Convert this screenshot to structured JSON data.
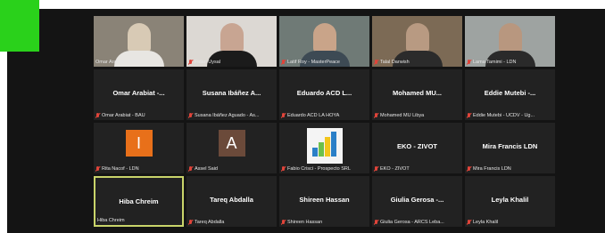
{
  "colors": {
    "background": "#141414",
    "tile": "#222222",
    "active_border": "#c9d46a",
    "mute": "#e0443a",
    "badge": "#2ad11b",
    "avatar_orange": "#e8701a",
    "avatar_brown": "#6b4a3a"
  },
  "tiles": [
    {
      "center": "",
      "label": "Omar Arabiat - BAU",
      "muted": false,
      "type": "video"
    },
    {
      "center": "",
      "label": "Fidan Uysal",
      "muted": true,
      "type": "video"
    },
    {
      "center": "",
      "label": "Latif Roy - MasterPeace",
      "muted": true,
      "type": "video"
    },
    {
      "center": "",
      "label": "Talal Darwish",
      "muted": true,
      "type": "video"
    },
    {
      "center": "",
      "label": "Lama Tamimi - LDN",
      "muted": true,
      "type": "video"
    },
    {
      "center": "Omar Arabiat -...",
      "label": "Omar Arabiat - BAU",
      "muted": true
    },
    {
      "center": "Susana Ibáñez A...",
      "label": "Susana Ibáñez Aguado - As...",
      "muted": true
    },
    {
      "center": "Eduardo ACD L...",
      "label": "Eduardo ACD LA HOYA",
      "muted": true
    },
    {
      "center": "Mohamed  MU...",
      "label": "Mohamed  MU Libya",
      "muted": true
    },
    {
      "center": "Eddie Mutebi -...",
      "label": "Eddie Mutebi - UCDV - Ug...",
      "muted": true
    },
    {
      "center": "",
      "label": "Rita Nacof - LDN",
      "muted": true,
      "avatar": "I"
    },
    {
      "center": "",
      "label": "Assel Said",
      "muted": true,
      "avatar": "A"
    },
    {
      "center": "",
      "label": "Fabio Crisci - Prospecto SRL",
      "muted": true,
      "logo": "logo-icon"
    },
    {
      "center": "EKO - ZIVOT",
      "label": "EKO - ZIVOT",
      "muted": true
    },
    {
      "center": "Mira Francis LDN",
      "label": "Mira Francis LDN",
      "muted": true
    },
    {
      "center": "Hiba Chreim",
      "label": "Hiba Chreim",
      "muted": false,
      "active": true
    },
    {
      "center": "Tareq Abdalla",
      "label": "Tareq Abdalla",
      "muted": true
    },
    {
      "center": "Shireen Hassan",
      "label": "Shireen Hassan",
      "muted": true
    },
    {
      "center": "Giulia Gerosa -...",
      "label": "Giulia Gerosa - ARCS Leba...",
      "muted": true
    },
    {
      "center": "Leyla Khalil",
      "label": "Leyla Khalil",
      "muted": true
    }
  ]
}
